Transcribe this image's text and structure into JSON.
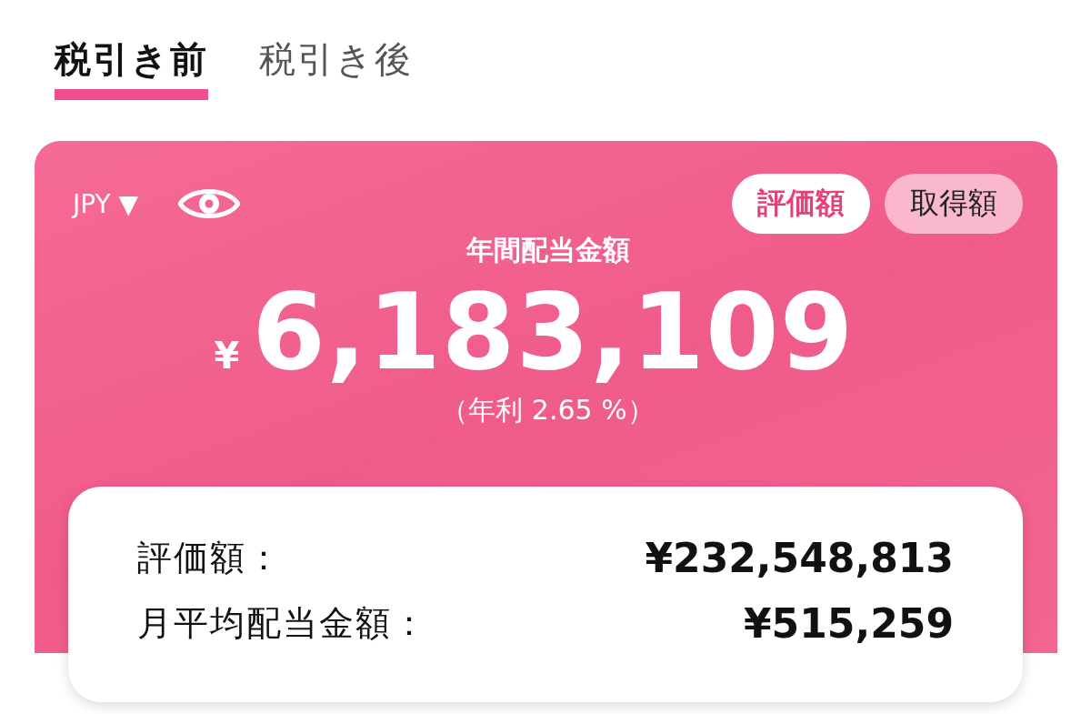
{
  "tabs": [
    {
      "label": "税引き前",
      "selected": true
    },
    {
      "label": "税引き後",
      "selected": false
    }
  ],
  "summary": {
    "currency": "JPY",
    "currency_caret": "▼",
    "basis_toggle": [
      {
        "label": "評価額",
        "selected": true
      },
      {
        "label": "取得額",
        "selected": false
      }
    ],
    "title": "年間配当金額",
    "currency_symbol": "¥",
    "amount": "6,183,109",
    "yield": "（年利 2.65 %）"
  },
  "details": [
    {
      "label": "評価額：",
      "value": "¥232,548,813"
    },
    {
      "label": "月平均配当金額：",
      "value": "¥515,259"
    }
  ]
}
